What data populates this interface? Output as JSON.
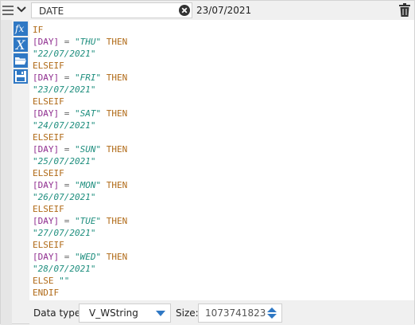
{
  "header": {
    "field_name": "DATE",
    "field_value": "23/07/2021"
  },
  "sidebar_tools": [
    "function-icon",
    "variable-icon",
    "open-icon",
    "save-icon"
  ],
  "code_lines": [
    [
      {
        "t": "kw",
        "v": "IF"
      }
    ],
    [
      {
        "t": "fld",
        "v": "[DAY]"
      },
      {
        "t": "op",
        "v": " = "
      },
      {
        "t": "str",
        "v": "\"THU\""
      },
      {
        "t": "op",
        "v": " "
      },
      {
        "t": "kw",
        "v": "THEN"
      }
    ],
    [
      {
        "t": "str",
        "v": "\"22/07/2021\""
      }
    ],
    [
      {
        "t": "kw",
        "v": "ELSEIF"
      }
    ],
    [
      {
        "t": "fld",
        "v": "[DAY]"
      },
      {
        "t": "op",
        "v": " = "
      },
      {
        "t": "str",
        "v": "\"FRI\""
      },
      {
        "t": "op",
        "v": " "
      },
      {
        "t": "kw",
        "v": "THEN"
      }
    ],
    [
      {
        "t": "str",
        "v": "\"23/07/2021\""
      }
    ],
    [
      {
        "t": "kw",
        "v": "ELSEIF"
      }
    ],
    [
      {
        "t": "fld",
        "v": "[DAY]"
      },
      {
        "t": "op",
        "v": " = "
      },
      {
        "t": "str",
        "v": "\"SAT\""
      },
      {
        "t": "op",
        "v": " "
      },
      {
        "t": "kw",
        "v": "THEN"
      }
    ],
    [
      {
        "t": "str",
        "v": "\"24/07/2021\""
      }
    ],
    [
      {
        "t": "kw",
        "v": "ELSEIF"
      }
    ],
    [
      {
        "t": "fld",
        "v": "[DAY]"
      },
      {
        "t": "op",
        "v": " = "
      },
      {
        "t": "str",
        "v": "\"SUN\""
      },
      {
        "t": "op",
        "v": " "
      },
      {
        "t": "kw",
        "v": "THEN"
      }
    ],
    [
      {
        "t": "str",
        "v": "\"25/07/2021\""
      }
    ],
    [
      {
        "t": "kw",
        "v": "ELSEIF"
      }
    ],
    [
      {
        "t": "fld",
        "v": "[DAY]"
      },
      {
        "t": "op",
        "v": " = "
      },
      {
        "t": "str",
        "v": "\"MON\""
      },
      {
        "t": "op",
        "v": " "
      },
      {
        "t": "kw",
        "v": "THEN"
      }
    ],
    [
      {
        "t": "str",
        "v": "\"26/07/2021\""
      }
    ],
    [
      {
        "t": "kw",
        "v": "ELSEIF"
      }
    ],
    [
      {
        "t": "fld",
        "v": "[DAY]"
      },
      {
        "t": "op",
        "v": " = "
      },
      {
        "t": "str",
        "v": "\"TUE\""
      },
      {
        "t": "op",
        "v": " "
      },
      {
        "t": "kw",
        "v": "THEN"
      }
    ],
    [
      {
        "t": "str",
        "v": "\"27/07/2021\""
      }
    ],
    [
      {
        "t": "kw",
        "v": "ELSEIF"
      }
    ],
    [
      {
        "t": "fld",
        "v": "[DAY]"
      },
      {
        "t": "op",
        "v": " = "
      },
      {
        "t": "str",
        "v": "\"WED\""
      },
      {
        "t": "op",
        "v": " "
      },
      {
        "t": "kw",
        "v": "THEN"
      }
    ],
    [
      {
        "t": "str",
        "v": "\"28/07/2021\""
      }
    ],
    [
      {
        "t": "kw",
        "v": "ELSE"
      },
      {
        "t": "op",
        "v": " "
      },
      {
        "t": "str",
        "v": "\"\""
      }
    ],
    [
      {
        "t": "kw",
        "v": "ENDIF"
      }
    ]
  ],
  "footer": {
    "data_type_label": "Data type:",
    "data_type_value": "V_WString",
    "size_label": "Size:",
    "size_value": "1073741823"
  },
  "colors": {
    "accent": "#2f78c4",
    "keyword": "#b06a17",
    "field": "#8f2d8f",
    "string": "#1e8e7e"
  }
}
